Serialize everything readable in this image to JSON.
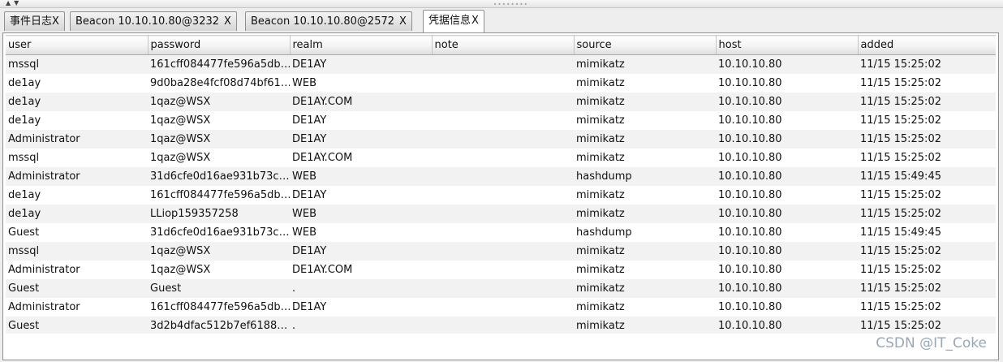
{
  "tabs": [
    {
      "label": "事件日志",
      "close": "X"
    },
    {
      "label": "Beacon 10.10.10.80@3232",
      "close": "X"
    },
    {
      "label": "Beacon 10.10.10.80@2572",
      "close": "X"
    },
    {
      "label": "凭据信息",
      "close": "X"
    }
  ],
  "table": {
    "columns": [
      "user",
      "password",
      "realm",
      "note",
      "source",
      "host",
      "added"
    ],
    "rows": [
      [
        "mssql",
        "161cff084477fe596a5db…",
        "DE1AY",
        "",
        "mimikatz",
        "10.10.10.80",
        "11/15 15:25:02"
      ],
      [
        "de1ay",
        "9d0ba28e4fcf08d74bf61…",
        "WEB",
        "",
        "mimikatz",
        "10.10.10.80",
        "11/15 15:25:02"
      ],
      [
        "de1ay",
        "1qaz@WSX",
        "DE1AY.COM",
        "",
        "mimikatz",
        "10.10.10.80",
        "11/15 15:25:02"
      ],
      [
        "de1ay",
        "1qaz@WSX",
        "DE1AY",
        "",
        "mimikatz",
        "10.10.10.80",
        "11/15 15:25:02"
      ],
      [
        "Administrator",
        "1qaz@WSX",
        "DE1AY",
        "",
        "mimikatz",
        "10.10.10.80",
        "11/15 15:25:02"
      ],
      [
        "mssql",
        "1qaz@WSX",
        "DE1AY.COM",
        "",
        "mimikatz",
        "10.10.10.80",
        "11/15 15:25:02"
      ],
      [
        "Administrator",
        "31d6cfe0d16ae931b73c…",
        "WEB",
        "",
        "hashdump",
        "10.10.10.80",
        "11/15 15:49:45"
      ],
      [
        "de1ay",
        "161cff084477fe596a5db…",
        "DE1AY",
        "",
        "mimikatz",
        "10.10.10.80",
        "11/15 15:25:02"
      ],
      [
        "de1ay",
        "LLiop159357258",
        "WEB",
        "",
        "mimikatz",
        "10.10.10.80",
        "11/15 15:25:02"
      ],
      [
        "Guest",
        "31d6cfe0d16ae931b73c…",
        "WEB",
        "",
        "hashdump",
        "10.10.10.80",
        "11/15 15:49:45"
      ],
      [
        "mssql",
        "1qaz@WSX",
        "DE1AY",
        "",
        "mimikatz",
        "10.10.10.80",
        "11/15 15:25:02"
      ],
      [
        "Administrator",
        "1qaz@WSX",
        "DE1AY.COM",
        "",
        "mimikatz",
        "10.10.10.80",
        "11/15 15:25:02"
      ],
      [
        "Guest",
        "Guest",
        ".",
        "",
        "mimikatz",
        "10.10.10.80",
        "11/15 15:25:02"
      ],
      [
        "Administrator",
        "161cff084477fe596a5db…",
        "DE1AY",
        "",
        "mimikatz",
        "10.10.10.80",
        "11/15 15:25:02"
      ],
      [
        "Guest",
        "3d2b4dfac512b7ef6188…",
        ".",
        "",
        "mimikatz",
        "10.10.10.80",
        "11/15 15:25:02"
      ]
    ]
  },
  "watermark": "CSDN @IT_Coke"
}
